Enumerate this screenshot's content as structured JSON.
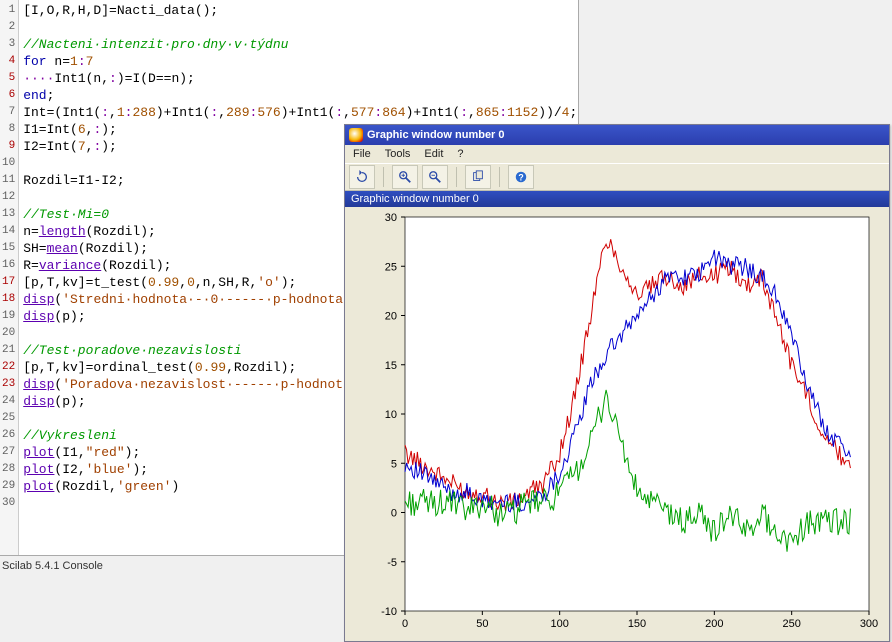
{
  "editor": {
    "lines": 30
  },
  "console_label": "Scilab 5.4.1 Console",
  "code": {
    "l1_a": "[I,O,R,H,D]=Nacti_data();",
    "l3_c": "//Nacteni·intenzit·pro·dny·v·týdnu",
    "l4_a": "for",
    "l4_b": " n=",
    "l4_c": "1",
    "l4_d": ":",
    "l4_e": "7",
    "l5_a": "····Int1(n,",
    "l5_b": ":",
    "l5_c": ")=I(D==n);",
    "l6_a": "end",
    "l6_b": ";",
    "l7_a": "Int=(Int1(",
    "l7_b": ":",
    "l7_c": ",",
    "l7_d": "1",
    "l7_e": ":",
    "l7_f": "288",
    "l7_g": ")+Int1(",
    "l7_h": ":",
    "l7_i": ",",
    "l7_j": "289",
    "l7_k": ":",
    "l7_l": "576",
    "l7_m": ")+Int1(",
    "l7_n": ":",
    "l7_o": ",",
    "l7_p": "577",
    "l7_q": ":",
    "l7_r": "864",
    "l7_s": ")+Int1(",
    "l7_t": ":",
    "l7_u": ",",
    "l7_v": "865",
    "l7_w": ":",
    "l7_x": "1152",
    "l7_y": "))/",
    "l7_z": "4",
    "l7_z2": ";",
    "l8_a": "I1=Int(",
    "l8_b": "6",
    "l8_c": ",",
    "l8_d": ":",
    "l8_e": ");",
    "l9_a": "I2=Int(",
    "l9_b": "7",
    "l9_c": ",",
    "l9_d": ":",
    "l9_e": ");",
    "l11": "Rozdil=I1-I2;",
    "l13_c": "//Test·Mi=0",
    "l14_a": "n=",
    "l14_b": "length",
    "l14_c": "(Rozdil);",
    "l15_a": "SH=",
    "l15_b": "mean",
    "l15_c": "(Rozdil);",
    "l16_a": "R=",
    "l16_b": "variance",
    "l16_c": "(Rozdil);",
    "l17_a": "[p,T,kv]=t_test(",
    "l17_b": "0.99",
    "l17_c": ",",
    "l17_d": "0",
    "l17_e": ",n,SH,R,",
    "l17_f": "'o'",
    "l17_g": ");",
    "l18_a": "disp",
    "l18_b": "(",
    "l18_c": "'Stredni·hodnota·-·0·-----·p-hodnota'",
    "l18_d": ");",
    "l19_a": "disp",
    "l19_b": "(p);",
    "l21_c": "//Test·poradove·nezavislosti",
    "l22_a": "[p,T,kv]=ordinal_test(",
    "l22_b": "0.99",
    "l22_c": ",Rozdil);",
    "l23_a": "disp",
    "l23_b": "(",
    "l23_c": "'Poradova·nezavislost·-----·p-hodnota'",
    "l23_d": ");",
    "l24_a": "disp",
    "l24_b": "(p);",
    "l26_c": "//Vykresleni",
    "l27_a": "plot",
    "l27_b": "(I1,",
    "l27_c": "\"red\"",
    "l27_d": ");",
    "l28_a": "plot",
    "l28_b": "(I2,",
    "l28_c": "'blue'",
    "l28_d": ");",
    "l29_a": "plot",
    "l29_b": "(Rozdil,",
    "l29_c": "'green'",
    "l29_d": ")"
  },
  "gwin": {
    "title": "Graphic window number 0",
    "menu": {
      "file": "File",
      "tools": "Tools",
      "edit": "Edit",
      "qmark": "?"
    },
    "tb": {
      "rotate": "rotate-icon",
      "zoom_in": "zoom-in-icon",
      "zoom_out": "zoom-out-icon",
      "copy": "copy-icon",
      "help": "help-icon"
    },
    "status": "Graphic window number 0"
  },
  "chart_data": {
    "type": "line",
    "xlabel": "",
    "ylabel": "",
    "xlim": [
      0,
      300
    ],
    "ylim": [
      -10,
      30
    ],
    "xticks": [
      0,
      50,
      100,
      150,
      200,
      250,
      300
    ],
    "yticks": [
      -10,
      -5,
      0,
      5,
      10,
      15,
      20,
      25,
      30
    ],
    "series": [
      {
        "name": "I1 (red)",
        "color": "#d00000",
        "x": [
          0,
          10,
          20,
          30,
          40,
          50,
          60,
          70,
          80,
          90,
          100,
          110,
          120,
          130,
          140,
          150,
          160,
          170,
          180,
          190,
          200,
          210,
          220,
          230,
          240,
          250,
          260,
          270,
          280,
          288
        ],
        "y": [
          6,
          5,
          4,
          3,
          2,
          2,
          1,
          1,
          2,
          3,
          6,
          12,
          20,
          28,
          25,
          22,
          23,
          24,
          23,
          24,
          24,
          25,
          23,
          24,
          20,
          15,
          12,
          8,
          6,
          5
        ]
      },
      {
        "name": "I2 (blue)",
        "color": "#0000d0",
        "x": [
          0,
          10,
          20,
          30,
          40,
          50,
          60,
          70,
          80,
          90,
          100,
          110,
          120,
          130,
          140,
          150,
          160,
          170,
          180,
          190,
          200,
          210,
          220,
          230,
          240,
          250,
          260,
          270,
          280,
          288
        ],
        "y": [
          5,
          4,
          3,
          2,
          2,
          1,
          1,
          1,
          1,
          2,
          4,
          8,
          13,
          16,
          18,
          20,
          22,
          24,
          24,
          24,
          26,
          25,
          25,
          24,
          22,
          18,
          13,
          9,
          7,
          6
        ]
      },
      {
        "name": "Rozdil (green)",
        "color": "#00a000",
        "x": [
          0,
          10,
          20,
          30,
          40,
          50,
          60,
          70,
          80,
          90,
          100,
          110,
          120,
          130,
          140,
          150,
          160,
          170,
          180,
          190,
          200,
          210,
          220,
          230,
          240,
          250,
          260,
          270,
          280,
          288
        ],
        "y": [
          1,
          1,
          1,
          1,
          0,
          1,
          0,
          0,
          1,
          1,
          2,
          4,
          7,
          12,
          7,
          2,
          1,
          0,
          -1,
          0,
          -2,
          0,
          -2,
          0,
          -2,
          -3,
          -1,
          -1,
          -1,
          -1
        ]
      }
    ]
  }
}
